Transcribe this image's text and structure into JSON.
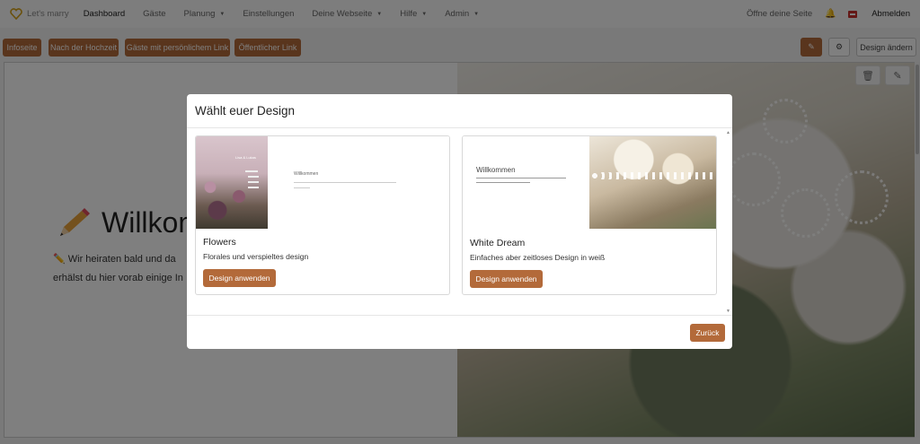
{
  "navbar": {
    "brand": "Let's marry",
    "items": [
      {
        "label": "Dashboard"
      },
      {
        "label": "Gäste"
      },
      {
        "label": "Planung"
      },
      {
        "label": "Einstellungen"
      },
      {
        "label": "Deine Webseite"
      },
      {
        "label": "Hilfe"
      },
      {
        "label": "Admin"
      }
    ],
    "open_page": "Öffne deine Seite",
    "logout": "Abmelden"
  },
  "toolbar": {
    "buttons": [
      {
        "label": "Infoseite"
      },
      {
        "label": "Nach der Hochzeit"
      },
      {
        "label": "Gäste mit persönlichem Link"
      },
      {
        "label": "Öffentlicher Link"
      }
    ],
    "design_change": "Design ändern"
  },
  "page": {
    "heading": "Willkommen",
    "line1": "Wir heiraten bald und da",
    "line2": "erhälst du hier vorab einige In"
  },
  "modal": {
    "title": "Wählt euer Design",
    "designs": [
      {
        "name": "Flowers",
        "description": "Florales und verspieltes design",
        "apply": "Design anwenden",
        "preview_heading": "Willkommen",
        "preview_names": "Lisa & Lukas"
      },
      {
        "name": "White Dream",
        "description": "Einfaches aber zeitloses Design in weiß",
        "apply": "Design anwenden",
        "preview_heading": "Willkommen"
      }
    ],
    "back": "Zurück"
  },
  "colors": {
    "accent": "#b36a3a",
    "backdrop": "rgba(0,0,0,0.5)"
  }
}
